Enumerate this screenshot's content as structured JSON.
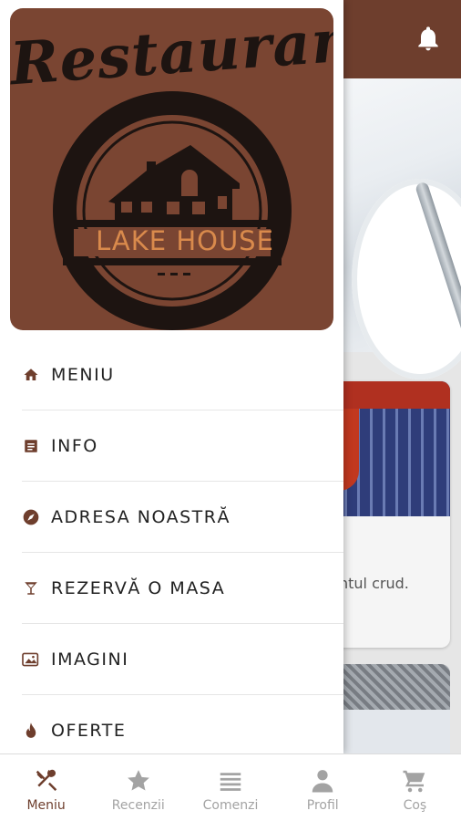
{
  "colors": {
    "brand": "#6e3e2d",
    "logo_bg": "#7a4532",
    "logo_accent": "#d98a4c",
    "inactive": "#a3a3a3"
  },
  "logo": {
    "wordmark": "Restaurant",
    "subtitle": "LAKE HOUSE"
  },
  "drawer_menu": [
    {
      "label": "MENIU",
      "icon": "home-icon"
    },
    {
      "label": "INFO",
      "icon": "info-icon"
    },
    {
      "label": "ADRESA NOASTRĂ",
      "icon": "compass-icon"
    },
    {
      "label": "REZERVĂ O MASA",
      "icon": "cocktail-icon"
    },
    {
      "label": "IMAGINI",
      "icon": "images-icon"
    },
    {
      "label": "OFERTE",
      "icon": "flame-icon"
    }
  ],
  "background": {
    "header_icon": "bell-icon",
    "card_text_fragment": "ntul crud."
  },
  "bottom_nav": [
    {
      "label": "Meniu",
      "icon": "fork-spoon-icon",
      "active": true
    },
    {
      "label": "Recenzii",
      "icon": "star-icon",
      "active": false
    },
    {
      "label": "Comenzi",
      "icon": "list-icon",
      "active": false
    },
    {
      "label": "Profil",
      "icon": "user-icon",
      "active": false
    },
    {
      "label": "Coş",
      "icon": "cart-icon",
      "active": false
    }
  ]
}
